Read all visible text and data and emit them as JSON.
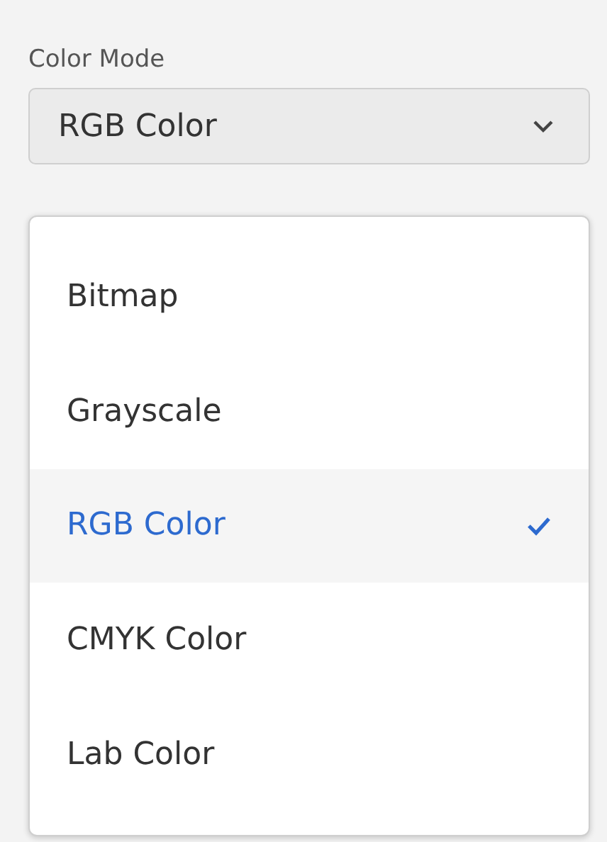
{
  "field_label": "Color Mode",
  "select": {
    "value": "RGB Color"
  },
  "options": [
    {
      "label": "Bitmap",
      "selected": false
    },
    {
      "label": "Grayscale",
      "selected": false
    },
    {
      "label": "RGB Color",
      "selected": true
    },
    {
      "label": "CMYK Color",
      "selected": false
    },
    {
      "label": "Lab Color",
      "selected": false
    }
  ]
}
